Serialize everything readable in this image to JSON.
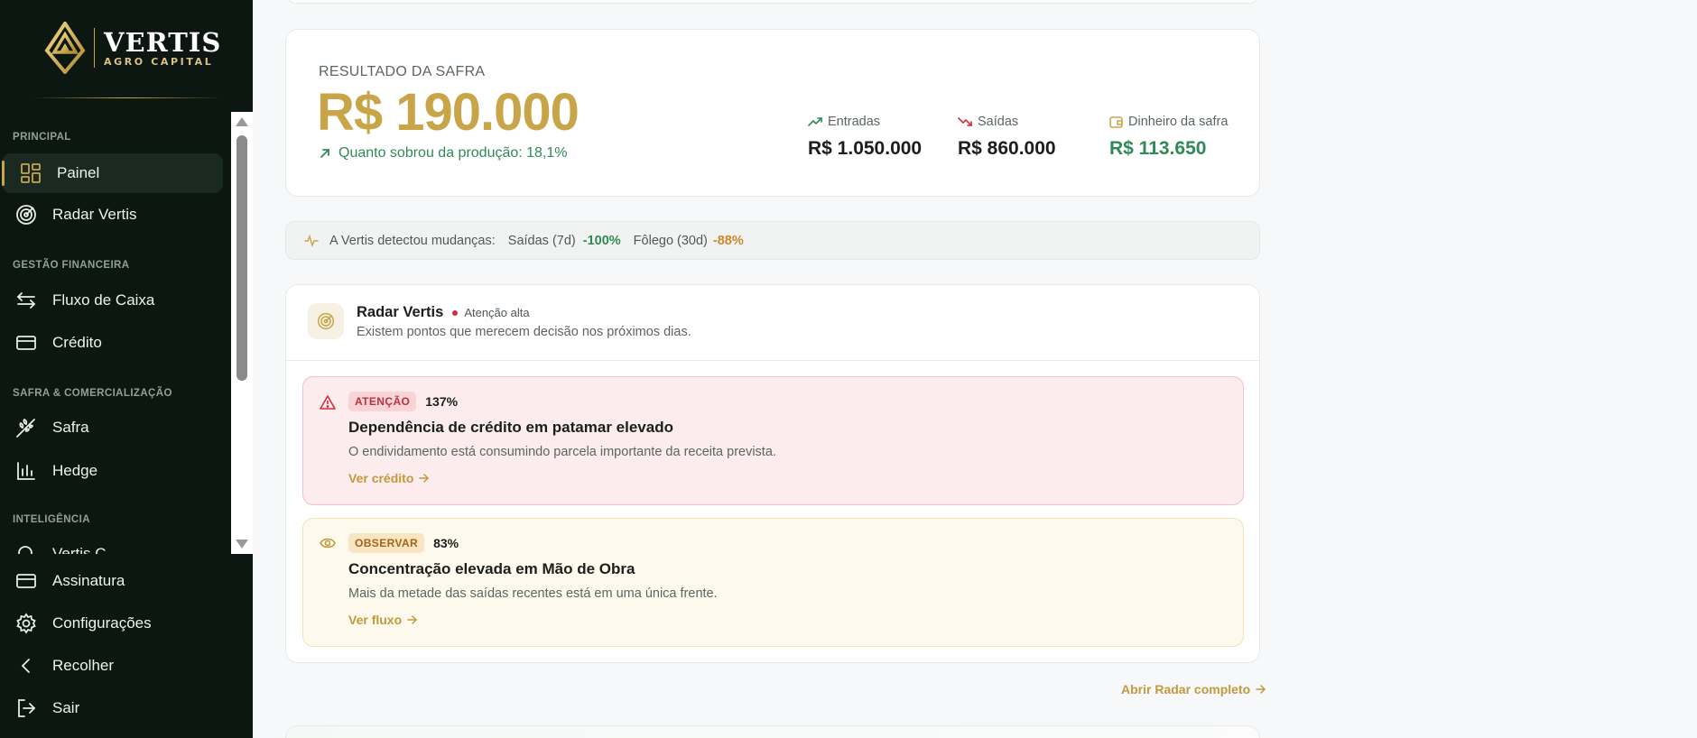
{
  "brand": {
    "name": "VERTIS",
    "subtitle": "AGRO CAPITAL"
  },
  "sidebar": {
    "sections": [
      {
        "label": "PRINCIPAL"
      },
      {
        "label": "GESTÃO FINANCEIRA"
      },
      {
        "label": "SAFRA & COMERCIALIZAÇÃO"
      },
      {
        "label": "INTELIGÊNCIA"
      }
    ],
    "items": [
      {
        "label": "Painel",
        "icon": "dashboard-icon",
        "active": true
      },
      {
        "label": "Radar Vertis",
        "icon": "radar-icon"
      },
      {
        "label": "Fluxo de Caixa",
        "icon": "arrows-exchange-icon"
      },
      {
        "label": "Crédito",
        "icon": "card-icon"
      },
      {
        "label": "Safra",
        "icon": "wheat-icon"
      },
      {
        "label": "Hedge",
        "icon": "bar-chart-icon"
      },
      {
        "label": "Vertis C...",
        "icon": "search-icon"
      }
    ],
    "bottom": [
      {
        "label": "Assinatura",
        "icon": "card-icon"
      },
      {
        "label": "Configurações",
        "icon": "gear-icon"
      },
      {
        "label": "Recolher",
        "icon": "chevron-left-icon"
      },
      {
        "label": "Sair",
        "icon": "logout-icon"
      }
    ]
  },
  "result": {
    "label": "RESULTADO DA SAFRA",
    "value": "R$ 190.000",
    "subtitle": "Quanto sobrou da produção: 18,1%",
    "metrics": [
      {
        "label": "Entradas",
        "value": "R$ 1.050.000",
        "icon": "trend-up-icon"
      },
      {
        "label": "Saídas",
        "value": "R$ 860.000",
        "icon": "trend-down-icon"
      },
      {
        "label": "Dinheiro da safra",
        "value": "R$ 113.650",
        "icon": "wallet-icon"
      }
    ]
  },
  "alert_bar": {
    "prefix": "A Vertis detectou mudanças:",
    "item1_label": "Saídas (7d)",
    "item1_value": "-100%",
    "item2_label": "Fôlego (30d)",
    "item2_value": "-88%"
  },
  "radar": {
    "title": "Radar Vertis",
    "badge": "Atenção alta",
    "description": "Existem pontos que merecem decisão nos próximos dias.",
    "insights": [
      {
        "tag": "ATENÇÃO",
        "pct": "137%",
        "title": "Dependência de crédito em patamar elevado",
        "description": "O endividamento está consumindo parcela importante da receita prevista.",
        "link": "Ver crédito"
      },
      {
        "tag": "OBSERVAR",
        "pct": "83%",
        "title": "Concentração elevada em Mão de Obra",
        "description": "Mais da metade das saídas recentes está em uma única frente.",
        "link": "Ver fluxo"
      }
    ],
    "open_link": "Abrir Radar completo"
  },
  "colors": {
    "sidebar_bg": "#0c1712",
    "gold": "#c9a54a",
    "green": "#2f8a57",
    "red_accent": "#d22f3a",
    "amber_accent": "#d0862a"
  }
}
